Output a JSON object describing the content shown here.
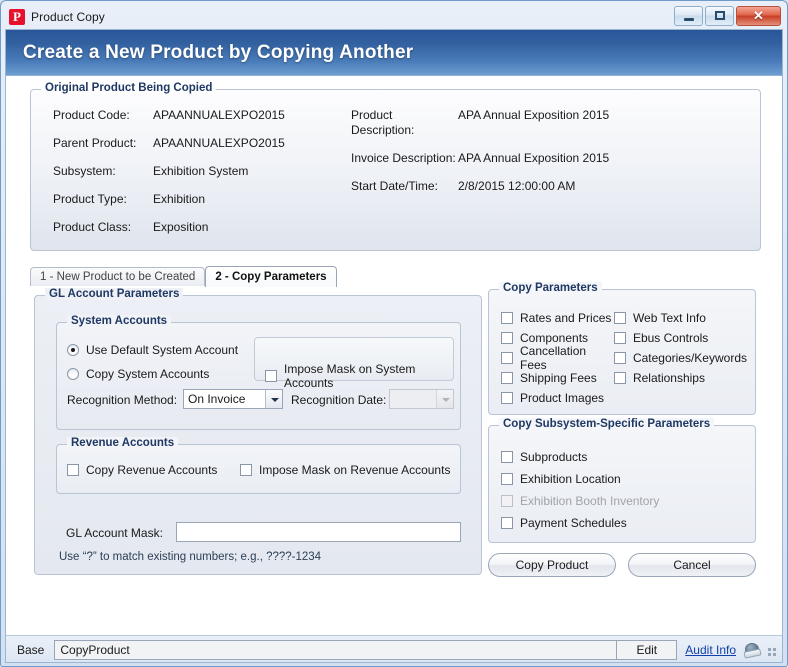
{
  "window": {
    "title": "Product Copy",
    "icon": "app-icon-p",
    "controls": {
      "minimize": "minimize-icon",
      "maximize": "maximize-icon",
      "close": "✕"
    }
  },
  "banner": {
    "title": "Create a New Product by Copying Another",
    "accent_color": "#2a5699"
  },
  "original_product": {
    "legend": "Original Product Being Copied",
    "left_fields": [
      {
        "label": "Product Code:",
        "value": "APAANNUALEXPO2015"
      },
      {
        "label": "Parent Product:",
        "value": "APAANNUALEXPO2015"
      },
      {
        "label": "Subsystem:",
        "value": "Exhibition System"
      },
      {
        "label": "Product Type:",
        "value": "Exhibition"
      },
      {
        "label": "Product Class:",
        "value": "Exposition"
      }
    ],
    "right_fields": [
      {
        "label": "Product Description:",
        "value": "APA Annual Exposition 2015"
      },
      {
        "label": "Invoice Description:",
        "value": "APA Annual Exposition 2015"
      },
      {
        "label": "Start Date/Time:",
        "value": "2/8/2015 12:00:00 AM"
      }
    ]
  },
  "tabs": [
    {
      "label": "1 - New Product to be Created",
      "active": false
    },
    {
      "label": "2 - Copy Parameters",
      "active": true
    }
  ],
  "gl_account": {
    "legend": "GL Account Parameters",
    "system_accounts": {
      "legend": "System Accounts",
      "radios": [
        {
          "label": "Use Default System Account",
          "checked": true
        },
        {
          "label": "Copy System Accounts",
          "checked": false
        }
      ],
      "impose_mask": {
        "label": "Impose Mask on System Accounts",
        "checked": false
      },
      "recognition_method_label": "Recognition Method:",
      "recognition_method_value": "On Invoice",
      "recognition_date_label": "Recognition Date:",
      "recognition_date_value": ""
    },
    "revenue_accounts": {
      "legend": "Revenue Accounts",
      "checkboxes": [
        {
          "label": "Copy Revenue Accounts",
          "checked": false
        },
        {
          "label": "Impose Mask on Revenue Accounts",
          "checked": false
        }
      ]
    },
    "mask_label": "GL Account Mask:",
    "mask_value": "",
    "mask_hint": "Use “?” to match existing numbers; e.g., ????-1234"
  },
  "copy_parameters": {
    "legend": "Copy Parameters",
    "column_a": [
      {
        "label": "Rates and Prices",
        "checked": false
      },
      {
        "label": "Components",
        "checked": false
      },
      {
        "label": "Cancellation Fees",
        "checked": false
      },
      {
        "label": "Shipping Fees",
        "checked": false
      },
      {
        "label": "Product Images",
        "checked": false
      }
    ],
    "column_b": [
      {
        "label": "Web Text Info",
        "checked": false
      },
      {
        "label": "Ebus Controls",
        "checked": false
      },
      {
        "label": "Categories/Keywords",
        "checked": false
      },
      {
        "label": "Relationships",
        "checked": false
      }
    ]
  },
  "subsystem_parameters": {
    "legend": "Copy Subsystem-Specific Parameters",
    "items": [
      {
        "label": "Subproducts",
        "checked": false,
        "disabled": false
      },
      {
        "label": "Exhibition Location",
        "checked": false,
        "disabled": false
      },
      {
        "label": "Exhibition Booth Inventory",
        "checked": false,
        "disabled": true
      },
      {
        "label": "Payment Schedules",
        "checked": false,
        "disabled": false
      }
    ]
  },
  "actions": {
    "primary": "Copy Product",
    "secondary": "Cancel"
  },
  "statusbar": {
    "label": "Base",
    "value": "CopyProduct",
    "edit": "Edit",
    "audit_link": "Audit Info",
    "globe_icon": "globe-icon",
    "grip_icon": "resize-grip-icon",
    "link_color": "#1340a8"
  }
}
